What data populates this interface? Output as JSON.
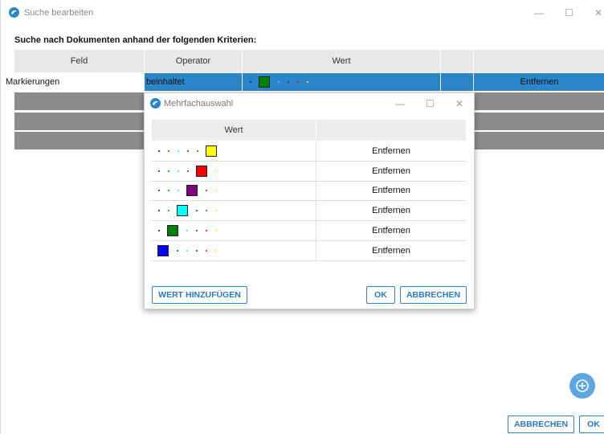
{
  "window": {
    "title": "Suche bearbeiten",
    "controls": [
      "—",
      "☐",
      "✕"
    ]
  },
  "heading": "Suche nach Dokumenten anhand der folgenden Kriterien:",
  "table": {
    "columns": [
      "Feld",
      "Operator",
      "Wert",
      ""
    ],
    "row": {
      "field": "Markierungen",
      "operator": "beinhaltet",
      "selected_color": "#008000",
      "remove_label": "Entfernen"
    },
    "empty_rows": 3
  },
  "dialog": {
    "title": "Mehrfachauswahl",
    "controls": [
      "—",
      "☐",
      "✕"
    ],
    "column_header": "Wert",
    "rows": [
      {
        "selected_color": "#ffff00",
        "remove_label": "Entfernen"
      },
      {
        "selected_color": "#ff0000",
        "remove_label": "Entfernen"
      },
      {
        "selected_color": "#800080",
        "remove_label": "Entfernen"
      },
      {
        "selected_color": "#00ffff",
        "remove_label": "Entfernen"
      },
      {
        "selected_color": "#008000",
        "remove_label": "Entfernen"
      },
      {
        "selected_color": "#0000ff",
        "remove_label": "Entfernen"
      }
    ],
    "add_button": "WERT HINZUFÜGEN",
    "ok_button": "OK",
    "cancel_button": "ABBRECHEN"
  },
  "footer": {
    "cancel_button": "ABBRECHEN",
    "ok_button": "OK"
  },
  "palette": [
    "#0000ff",
    "#008000",
    "#00ffff",
    "#800080",
    "#ff0000",
    "#ffff00"
  ],
  "colors": {
    "accent": "#2b86c9",
    "selected_row": "#2b86c9",
    "empty_row": "#8c8c8c",
    "header_bg": "#e8e8e8"
  }
}
